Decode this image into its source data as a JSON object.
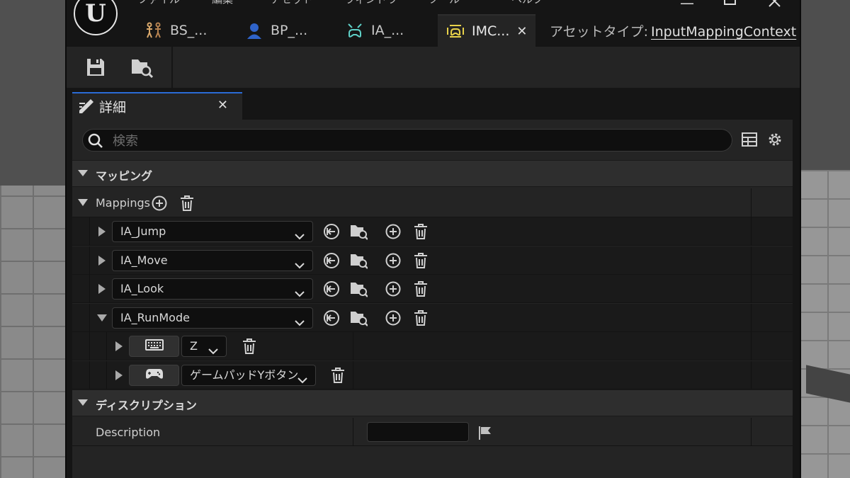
{
  "app": {
    "logo": "unreal-engine-logo",
    "menu": [
      "ファイル",
      "編集",
      "アセット",
      "ウィンドウ",
      "ツール",
      "ヘルプ"
    ]
  },
  "tabs": [
    {
      "label": "BS_...",
      "icon": "blendspace-icon"
    },
    {
      "label": "BP_...",
      "icon": "blueprint-character-icon"
    },
    {
      "label": "IA_...",
      "icon": "input-action-icon"
    },
    {
      "label": "IMC...",
      "icon": "input-mapping-context-icon",
      "active": true
    }
  ],
  "asset_type": {
    "label": "アセットタイプ:",
    "value": "InputMappingContext"
  },
  "details_panel": {
    "tab_label": "詳細",
    "search_placeholder": "検索"
  },
  "categories": {
    "mapping": "マッピング",
    "description": "ディスクリプション"
  },
  "mappings": {
    "label": "Mappings",
    "items": [
      {
        "action": "IA_Jump",
        "expanded": false
      },
      {
        "action": "IA_Move",
        "expanded": false
      },
      {
        "action": "IA_Look",
        "expanded": false
      },
      {
        "action": "IA_RunMode",
        "expanded": true,
        "keys": [
          {
            "icon": "keyboard-icon",
            "key": "Z"
          },
          {
            "icon": "gamepad-icon",
            "key": "ゲームパッドYボタン"
          }
        ]
      }
    ]
  },
  "description": {
    "label": "Description",
    "value": ""
  },
  "colors": {
    "accent": "#2a6bd6",
    "panel": "#242424",
    "background": "#151515"
  }
}
